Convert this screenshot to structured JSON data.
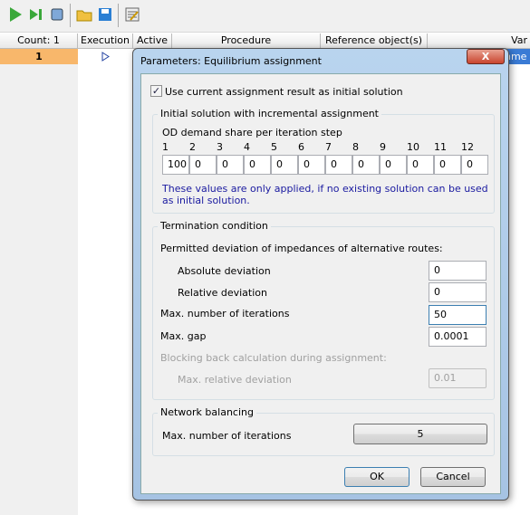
{
  "toolbar": {
    "icons": [
      "run-icon",
      "run-step-icon",
      "stop-icon",
      "open-folder-icon",
      "save-icon",
      "edit-list-icon"
    ]
  },
  "table": {
    "headers": [
      "Count: 1",
      "Execution",
      "Active",
      "Procedure",
      "Reference object(s)",
      "Var"
    ],
    "row": {
      "number": "1",
      "execution_icon": "play-outline-icon",
      "partial_value": "nme"
    }
  },
  "dialog": {
    "title": "Parameters: Equilibrium assignment",
    "use_current_label": "Use current assignment result as initial solution",
    "use_current_checked": true,
    "initial_group": {
      "title": "Initial solution with incremental assignment",
      "share_label": "OD demand share per iteration step",
      "steps": [
        "1",
        "2",
        "3",
        "4",
        "5",
        "6",
        "7",
        "8",
        "9",
        "10",
        "11",
        "12"
      ],
      "values": [
        "100",
        "0",
        "0",
        "0",
        "0",
        "0",
        "0",
        "0",
        "0",
        "0",
        "0",
        "0"
      ],
      "note": "These values are only applied, if no existing solution can be used as initial solution."
    },
    "termination": {
      "title": "Termination condition",
      "permitted_label": "Permitted deviation of impedances of alternative routes:",
      "absolute_label": "Absolute deviation",
      "absolute_value": "0",
      "relative_label": "Relative deviation",
      "relative_value": "0",
      "max_iter_label": "Max. number of iterations",
      "max_iter_value": "50",
      "max_gap_label": "Max. gap",
      "max_gap_value": "0.0001",
      "blocking_label": "Blocking back calculation during assignment:",
      "max_rel_dev_label": "Max. relative deviation",
      "max_rel_dev_value": "0.01"
    },
    "network": {
      "title": "Network balancing",
      "max_iter_label": "Max. number of iterations",
      "max_iter_value": "5"
    },
    "ok_label": "OK",
    "cancel_label": "Cancel",
    "close_label": "X"
  },
  "colors": {
    "row_highlight": "#f8b76b",
    "note_text": "#1a1aa0",
    "title_bar": "#b9d4ee"
  }
}
